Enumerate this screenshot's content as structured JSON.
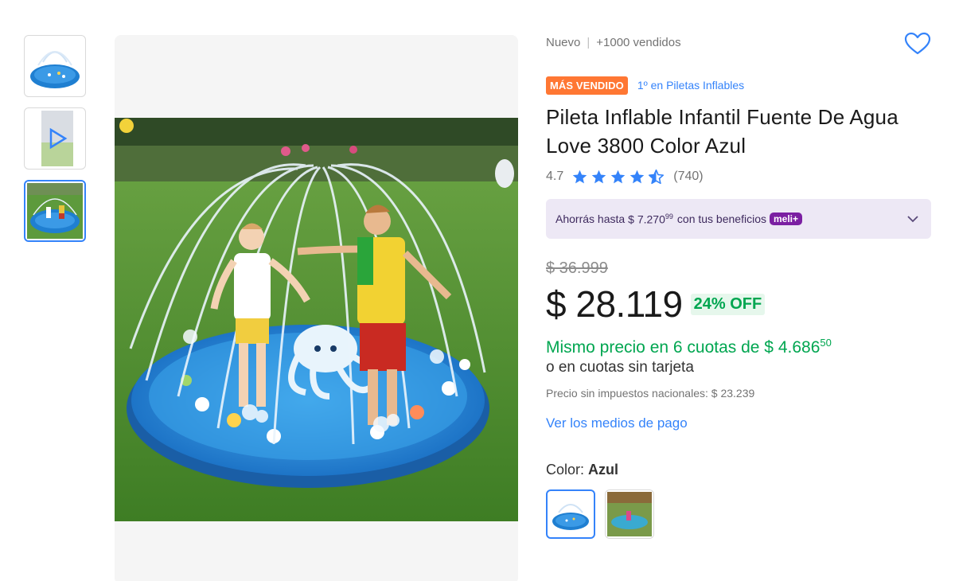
{
  "thumbnails": [
    {
      "name": "thumb-pool-product"
    },
    {
      "name": "thumb-video"
    },
    {
      "name": "thumb-kids-playing"
    }
  ],
  "product": {
    "condition": "Nuevo",
    "separator": "|",
    "sold": "+1000 vendidos",
    "best_seller_badge": "MÁS VENDIDO",
    "ranking": "1º en Piletas Inflables",
    "title": "Pileta Inflable Infantil Fuente De Agua Love 3800 Color Azul",
    "rating_score": "4.7",
    "rating_stars": 4.7,
    "rating_count": "(740)"
  },
  "benefits": {
    "text": "Ahorrás hasta",
    "amount": "$ 7.270",
    "amount_cents": "99",
    "text2": "con tus beneficios",
    "program": "meli+"
  },
  "pricing": {
    "original_price": "$ 36.999",
    "price": "$ 28.119",
    "discount": "24% OFF",
    "installments": "Mismo precio en 6 cuotas de $ 4.686",
    "installments_cents": "50",
    "no_card": "o en cuotas sin tarjeta",
    "tax_info": "Precio sin impuestos nacionales: $ 23.239",
    "payment_link": "Ver los medios de pago"
  },
  "color": {
    "label": "Color:",
    "selected": "Azul"
  },
  "colors": {
    "accent": "#3483fa",
    "green": "#00a650",
    "orange_badge": "#ff7733",
    "benefits_bg": "#ede8f5"
  }
}
